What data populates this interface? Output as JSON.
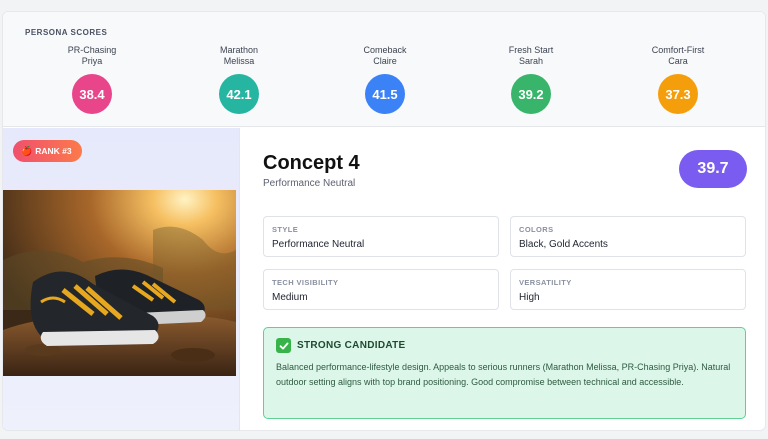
{
  "persona_section": {
    "title": "PERSONA SCORES",
    "personas": [
      {
        "name": "PR-Chasing\nPriya",
        "score": "38.4",
        "color": "#e8458b"
      },
      {
        "name": "Marathon\nMelissa",
        "score": "42.1",
        "color": "#26b5a0"
      },
      {
        "name": "Comeback\nClaire",
        "score": "41.5",
        "color": "#3b82f6"
      },
      {
        "name": "Fresh Start\nSarah",
        "score": "39.2",
        "color": "#38b56a"
      },
      {
        "name": "Comfort-First\nCara",
        "score": "37.3",
        "color": "#f59e0b"
      }
    ]
  },
  "rank": {
    "icon": "apple-icon",
    "label": "RANK #3"
  },
  "concept": {
    "title": "Concept 4",
    "subtitle": "Performance Neutral",
    "overall_score": "39.7"
  },
  "attributes": [
    {
      "label": "STYLE",
      "value": "Performance Neutral"
    },
    {
      "label": "COLORS",
      "value": "Black, Gold Accents"
    },
    {
      "label": "TECH VISIBILITY",
      "value": "Medium"
    },
    {
      "label": "VERSATILITY",
      "value": "High"
    }
  ],
  "verdict": {
    "icon": "check-icon",
    "title": "STRONG CANDIDATE",
    "text": "Balanced performance-lifestyle design. Appeals to serious runners (Marathon Melissa, PR-Chasing Priya). Natural outdoor setting aligns with top brand positioning. Good compromise between technical and accessible."
  }
}
